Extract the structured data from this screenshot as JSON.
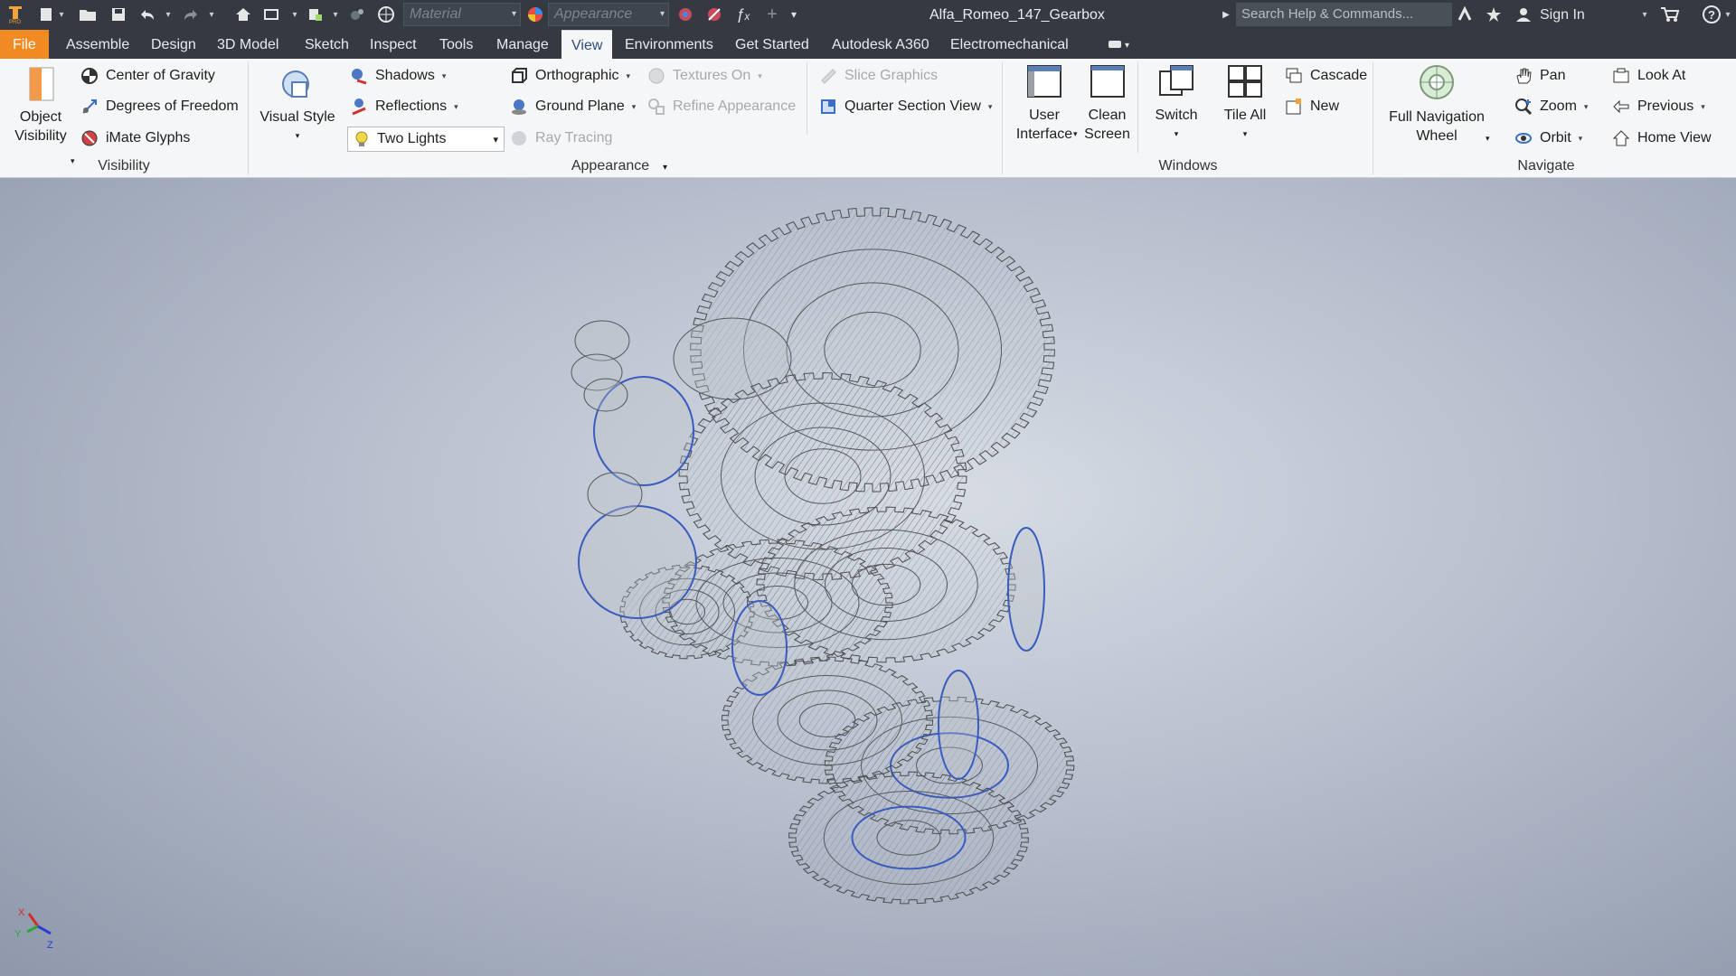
{
  "window": {
    "title": "Alfa_Romeo_147_Gearbox",
    "material_placeholder": "Material",
    "appearance_placeholder": "Appearance",
    "search_placeholder": "Search Help & Commands...",
    "sign_in": "Sign In"
  },
  "tabs": [
    "File",
    "Assemble",
    "Design",
    "3D Model",
    "Sketch",
    "Inspect",
    "Tools",
    "Manage",
    "View",
    "Environments",
    "Get Started",
    "Autodesk A360",
    "Electromechanical"
  ],
  "active_tab": "View",
  "ribbon": {
    "visibility": {
      "title": "Visibility",
      "object_visibility": "Object Visibility",
      "items": [
        "Center of Gravity",
        "Degrees of Freedom",
        "iMate Glyphs"
      ]
    },
    "appearance": {
      "title": "Appearance",
      "visual_style": "Visual Style",
      "shadows": "Shadows",
      "reflections": "Reflections",
      "lighting": "Two Lights",
      "orthographic": "Orthographic",
      "ground_plane": "Ground Plane",
      "ray_tracing": "Ray Tracing",
      "textures_on": "Textures On",
      "refine_appearance": "Refine Appearance",
      "slice_graphics": "Slice Graphics",
      "quarter_section_view": "Quarter Section View"
    },
    "windows": {
      "title": "Windows",
      "user_interface": "User Interface",
      "clean_screen": "Clean Screen",
      "switch": "Switch",
      "tile_all": "Tile All",
      "cascade": "Cascade",
      "new": "New"
    },
    "navigate": {
      "title": "Navigate",
      "full_navigation_wheel": "Full Navigation Wheel",
      "pan": "Pan",
      "zoom": "Zoom",
      "orbit": "Orbit",
      "look_at": "Look At",
      "previous": "Previous",
      "home_view": "Home View"
    }
  },
  "colors": {
    "title_bg": "#353a42",
    "file_tab": "#f28a24",
    "ribbon_bg": "#f5f6f7",
    "viewport_center": "#d7dce4",
    "viewport_edge": "#8f98ab",
    "highlight_edges": "#3a5bbf"
  }
}
